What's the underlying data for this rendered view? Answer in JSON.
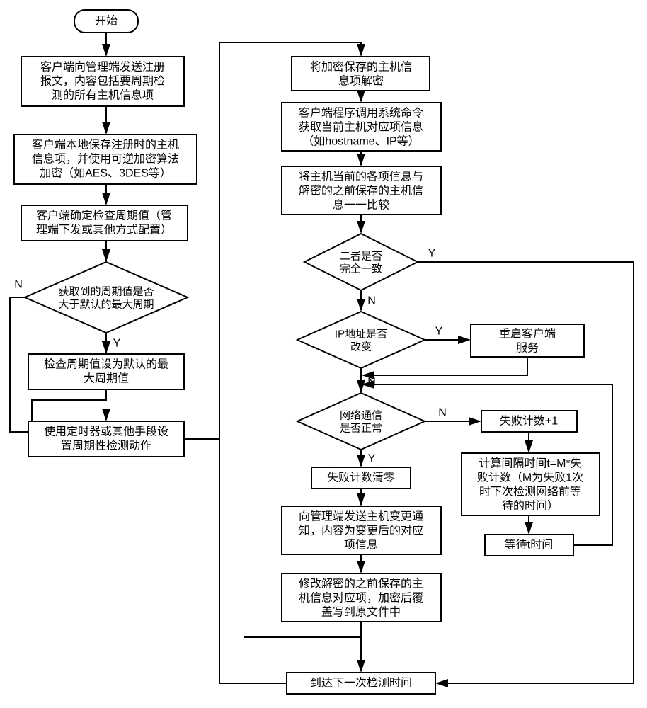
{
  "chart_data": {
    "type": "flowchart",
    "nodes": [
      {
        "id": "start",
        "shape": "terminator",
        "text": "开始"
      },
      {
        "id": "a1",
        "shape": "rect",
        "text": "客户端向管理端发送注册报文，内容包括要周期检测的所有主机信息项"
      },
      {
        "id": "a2",
        "shape": "rect",
        "text": "客户端本地保存注册时的主机信息项，并使用可逆加密算法加密（如AES、3DES等）"
      },
      {
        "id": "a3",
        "shape": "rect",
        "text": "客户端确定检查周期值（管理端下发或其他方式配置）"
      },
      {
        "id": "d1",
        "shape": "diamond",
        "text": "获取到的周期值是否大于默认的最大周期"
      },
      {
        "id": "a4",
        "shape": "rect",
        "text": "检查周期值设为默认的最大周期值"
      },
      {
        "id": "a5",
        "shape": "rect",
        "text": "使用定时器或其他手段设置周期性检测动作"
      },
      {
        "id": "b1",
        "shape": "rect",
        "text": "将加密保存的主机信息项解密"
      },
      {
        "id": "b2",
        "shape": "rect",
        "text": "客户端程序调用系统命令获取当前主机对应项信息（如hostname、IP等）"
      },
      {
        "id": "b3",
        "shape": "rect",
        "text": "将主机当前的各项信息与解密的之前保存的主机信息一一比较"
      },
      {
        "id": "d2",
        "shape": "diamond",
        "text": "二者是否完全一致"
      },
      {
        "id": "d3",
        "shape": "diamond",
        "text": "IP地址是否改变"
      },
      {
        "id": "b4",
        "shape": "rect",
        "text": "重启客户端服务"
      },
      {
        "id": "d4",
        "shape": "diamond",
        "text": "网络通信是否正常"
      },
      {
        "id": "b5",
        "shape": "rect",
        "text": "失败计数+1"
      },
      {
        "id": "b6",
        "shape": "rect",
        "text": "计算间隔时间t=M*失败计数（M为失败1次时下次检测网络前等待的时间）"
      },
      {
        "id": "b7",
        "shape": "rect",
        "text": "等待t时间"
      },
      {
        "id": "b8",
        "shape": "rect",
        "text": "失败计数清零"
      },
      {
        "id": "b9",
        "shape": "rect",
        "text": "向管理端发送主机变更通知，内容为变更后的对应项信息"
      },
      {
        "id": "b10",
        "shape": "rect",
        "text": "修改解密的之前保存的主机信息对应项，加密后覆盖写到原文件中"
      },
      {
        "id": "b11",
        "shape": "rect",
        "text": "到达下一次检测时间"
      }
    ],
    "edges": [
      {
        "from": "start",
        "to": "a1"
      },
      {
        "from": "a1",
        "to": "a2"
      },
      {
        "from": "a2",
        "to": "a3"
      },
      {
        "from": "a3",
        "to": "d1"
      },
      {
        "from": "d1",
        "to": "a4",
        "label": "Y"
      },
      {
        "from": "d1",
        "to": "a5",
        "label": "N",
        "path": "left-down"
      },
      {
        "from": "a4",
        "to": "a5",
        "path": "down-left-down"
      },
      {
        "from": "a5",
        "to": "b1",
        "path": "right-up"
      },
      {
        "from": "b1",
        "to": "b2"
      },
      {
        "from": "b2",
        "to": "b3"
      },
      {
        "from": "b3",
        "to": "d2"
      },
      {
        "from": "d2",
        "to": "d3",
        "label": "N"
      },
      {
        "from": "d2",
        "to": "b11",
        "label": "Y",
        "path": "right-far-down"
      },
      {
        "from": "d3",
        "to": "b4",
        "label": "Y"
      },
      {
        "from": "d3",
        "to": "d4",
        "label": "N"
      },
      {
        "from": "b4",
        "to": "d4",
        "path": "down-left"
      },
      {
        "from": "d4",
        "to": "b8",
        "label": "Y"
      },
      {
        "from": "d4",
        "to": "b5",
        "label": "N"
      },
      {
        "from": "b5",
        "to": "b6"
      },
      {
        "from": "b6",
        "to": "b7"
      },
      {
        "from": "b7",
        "to": "d4",
        "path": "right-up-left"
      },
      {
        "from": "b8",
        "to": "b9"
      },
      {
        "from": "b9",
        "to": "b10"
      },
      {
        "from": "b10",
        "to": "b11"
      },
      {
        "from": "b11",
        "to": "b1",
        "path": "left-up",
        "loop": true
      }
    ]
  },
  "labels": {
    "Y": "Y",
    "N": "N"
  },
  "nodes": {
    "start": "开始",
    "a1_l1": "客户端向管理端发送注册",
    "a1_l2": "报文，内容包括要周期检",
    "a1_l3": "测的所有主机信息项",
    "a2_l1": "客户端本地保存注册时的主机",
    "a2_l2": "信息项，并使用可逆加密算法",
    "a2_l3": "加密（如AES、3DES等）",
    "a3_l1": "客户端确定检查周期值（管",
    "a3_l2": "理端下发或其他方式配置）",
    "d1_l1": "获取到的周期值是否",
    "d1_l2": "大于默认的最大周期",
    "a4_l1": "检查周期值设为默认的最",
    "a4_l2": "大周期值",
    "a5_l1": "使用定时器或其他手段设",
    "a5_l2": "置周期性检测动作",
    "b1_l1": "将加密保存的主机信",
    "b1_l2": "息项解密",
    "b2_l1": "客户端程序调用系统命令",
    "b2_l2": "获取当前主机对应项信息",
    "b2_l3": "（如hostname、IP等）",
    "b3_l1": "将主机当前的各项信息与",
    "b3_l2": "解密的之前保存的主机信",
    "b3_l3": "息一一比较",
    "d2_l1": "二者是否",
    "d2_l2": "完全一致",
    "d3_l1": "IP地址是否",
    "d3_l2": "改变",
    "b4_l1": "重启客户端",
    "b4_l2": "服务",
    "d4_l1": "网络通信",
    "d4_l2": "是否正常",
    "b5": "失败计数+1",
    "b6_l1": "计算间隔时间t=M*失",
    "b6_l2": "败计数（M为失败1次",
    "b6_l3": "时下次检测网络前等",
    "b6_l4": "待的时间）",
    "b7": "等待t时间",
    "b8": "失败计数清零",
    "b9_l1": "向管理端发送主机变更通",
    "b9_l2": "知，内容为变更后的对应",
    "b9_l3": "项信息",
    "b10_l1": "修改解密的之前保存的主",
    "b10_l2": "机信息对应项，加密后覆",
    "b10_l3": "盖写到原文件中",
    "b11": "到达下一次检测时间"
  }
}
